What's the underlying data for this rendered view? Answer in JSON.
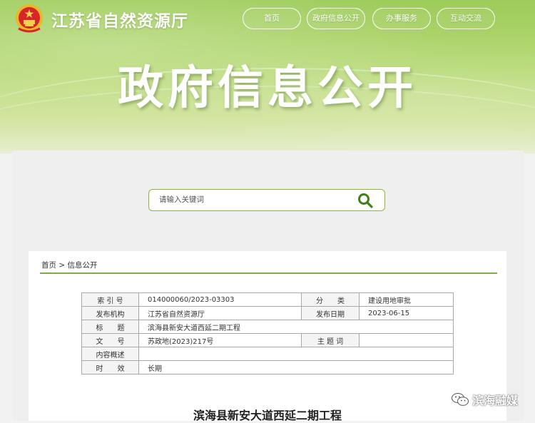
{
  "header": {
    "site_name": "江苏省自然资源厅",
    "nav": [
      "首页",
      "政府信息公开",
      "办事服务",
      "互动交流"
    ],
    "banner_title": "政府信息公开"
  },
  "search": {
    "placeholder": "请输入关键词",
    "icon": "search-icon"
  },
  "breadcrumb": {
    "home": "首页",
    "separator": ">",
    "current": "信息公开"
  },
  "meta_table": {
    "index_label": "索 引 号",
    "index_value": "014000060/2023-03303",
    "category_label": "分　　类",
    "category_value": "建设用地审批",
    "publisher_label": "发布机构",
    "publisher_value": "江苏省自然资源厅",
    "date_label": "发布日期",
    "date_value": "2023-06-15",
    "title_label": "标　　题",
    "title_value": "滨海县新安大道西延二期工程",
    "doc_no_label": "文　　号",
    "doc_no_value": "苏政地(2023)217号",
    "keywords_label": "主 题 词",
    "keywords_value": "",
    "summary_label": "内容概述",
    "summary_value": "",
    "validity_label": "时　　效",
    "validity_value": "长期"
  },
  "article": {
    "title": "滨海县新安大道西延二期工程"
  },
  "watermark": {
    "text": "滨海融媒",
    "icon": "wechat-icon"
  },
  "colors": {
    "accent_green": "#7fae3c",
    "banner_green": "#9dcc5a"
  }
}
